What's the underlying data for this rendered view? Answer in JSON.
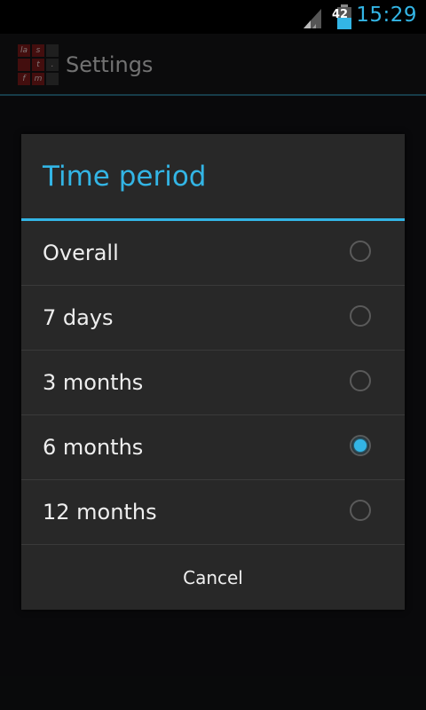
{
  "status_bar": {
    "battery_level": "42",
    "time": "15:29",
    "icons": [
      "signal-icon",
      "battery-icon"
    ],
    "accent_color": "#33b5e5"
  },
  "action_bar": {
    "title": "Settings",
    "logo": {
      "name": "lastfm-logo",
      "cells": [
        "la",
        "s",
        "t",
        ".",
        "f",
        "m"
      ]
    }
  },
  "dialog": {
    "title": "Time period",
    "options": [
      {
        "label": "Overall",
        "checked": false
      },
      {
        "label": "7 days",
        "checked": false
      },
      {
        "label": "3 months",
        "checked": false
      },
      {
        "label": "6 months",
        "checked": true
      },
      {
        "label": "12 months",
        "checked": false
      }
    ],
    "selected": "6 months",
    "cancel_label": "Cancel"
  }
}
